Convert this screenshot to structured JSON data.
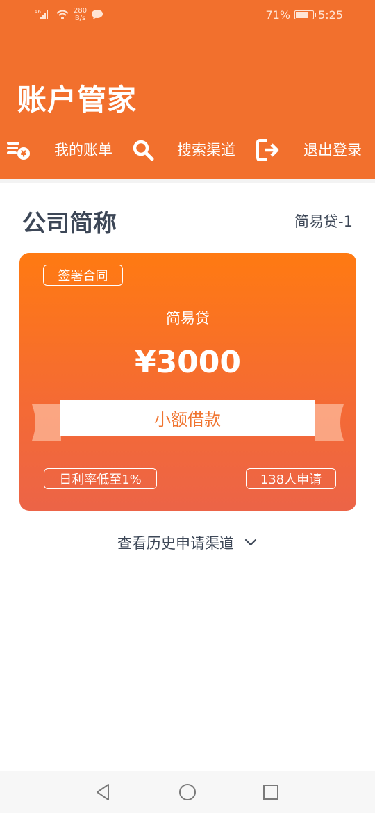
{
  "status_bar": {
    "network_speed_value": "280",
    "network_speed_unit": "B/s",
    "battery": "71%",
    "time": "5:25",
    "icons": [
      "signal-icon",
      "wifi-icon",
      "chat-bubble-icon",
      "battery-icon"
    ]
  },
  "header": {
    "title": "账户管家",
    "background_color": "#f2702d"
  },
  "nav": [
    {
      "label": "我的账单",
      "icon": "bill-coins-icon"
    },
    {
      "label": "搜索渠道",
      "icon": "search-icon"
    },
    {
      "label": "退出登录",
      "icon": "logout-icon"
    }
  ],
  "section": {
    "company": "公司简称",
    "product_tag": "简易贷-1"
  },
  "card": {
    "contract_badge": "签署合同",
    "name": "简易贷",
    "amount": "¥3000",
    "ribbon_label": "小额借款",
    "rate_badge": "日利率低至1%",
    "applicants_badge": "138人申请",
    "accent_color": "#ff7a12"
  },
  "history_link": {
    "label": "查看历史申请渠道",
    "icon": "chevron-down-icon"
  },
  "system_nav": {
    "icons": [
      "back-triangle-icon",
      "home-circle-icon",
      "recents-square-icon"
    ]
  }
}
